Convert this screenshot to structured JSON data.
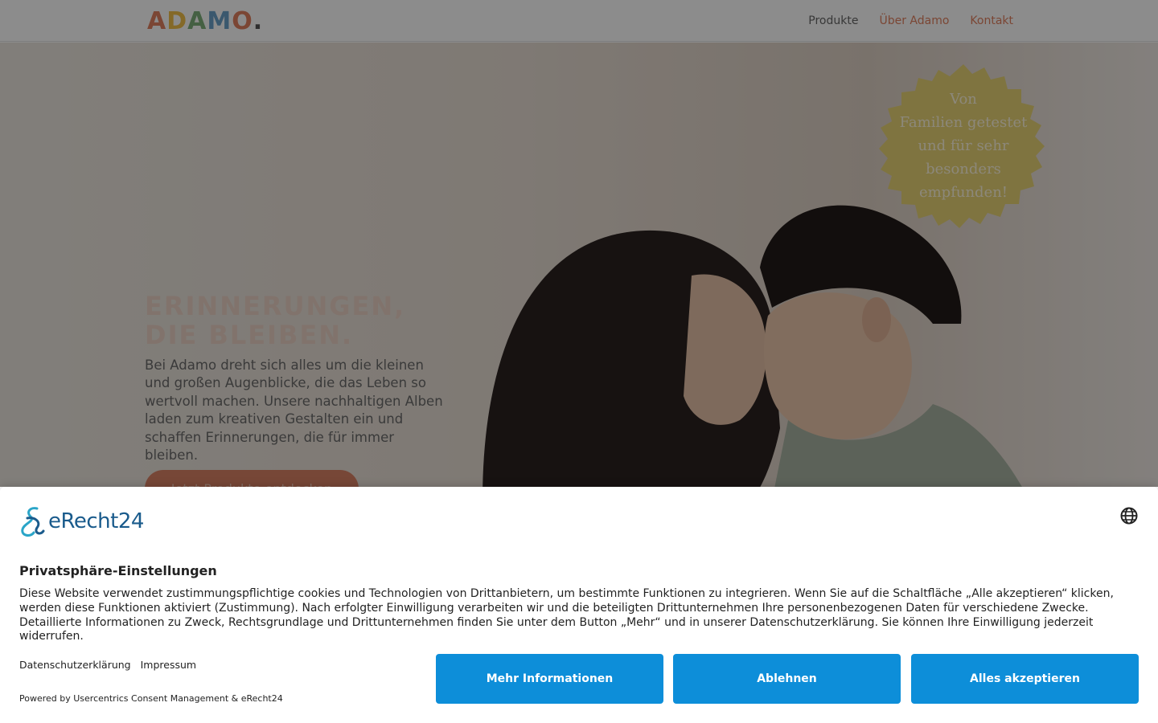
{
  "header": {
    "logo": [
      "A",
      "D",
      "A",
      "M",
      "O",
      "."
    ],
    "logo_colors": [
      "#e0805f",
      "#f0c04a",
      "#7fb07a",
      "#6aa0c8",
      "#e0805f",
      "#555555"
    ],
    "nav": [
      {
        "label": "Produkte"
      },
      {
        "label": "Über Adamo"
      },
      {
        "label": "Kontakt"
      }
    ]
  },
  "hero": {
    "title_line1": "Erinnerungen,",
    "title_line2": "die bleiben.",
    "text": "Bei Adamo dreht sich alles um die kleinen und großen Augenblicke, die das Leben so wertvoll machen. Unsere nachhaltigen Alben laden zum kreativen Gestalten ein und schaffen Erinnerungen, die für immer bleiben.",
    "cta": "Jetzt Produkte entdecken",
    "badge_lines": [
      "Von",
      "Familien getestet",
      "und für sehr",
      "besonders",
      "empfunden!"
    ]
  },
  "consent": {
    "brand": "eRecht24",
    "title": "Privatsphäre-Einstellungen",
    "text": "Diese Website verwendet zustimmungspflichtige cookies und Technologien von Drittanbietern, um bestimmte Funktionen zu integrieren. Wenn Sie auf die Schaltfläche „Alle akzeptieren“ klicken, werden diese Funktionen aktiviert (Zustimmung). Nach erfolgter Einwilligung verarbeiten wir und die beteiligten Drittunternehmen Ihre personenbezogenen Daten für verschiedene Zwecke. Detaillierte Informationen zu Zweck, Rechtsgrundlage und Drittunternehmen finden Sie unter dem Button „Mehr“ und in unserer Datenschutzerklärung. Sie können Ihre Einwilligung jederzeit widerrufen.",
    "links": [
      "Datenschutzerklärung",
      "Impressum"
    ],
    "powered": "Powered by Usercentrics Consent Management & eRecht24",
    "buttons": {
      "more": "Mehr Informationen",
      "deny": "Ablehnen",
      "accept": "Alles akzeptieren"
    },
    "button_color": "#0d8ed9"
  }
}
